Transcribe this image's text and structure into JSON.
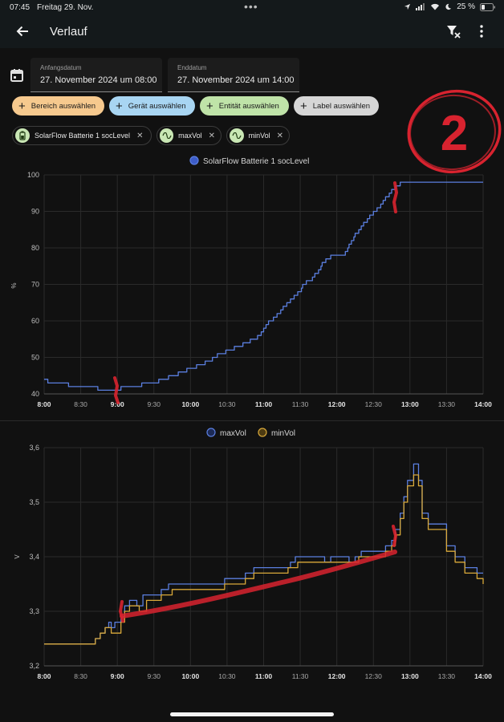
{
  "status": {
    "time": "07:45",
    "date": "Freitag 29. Nov.",
    "battery": "25 %"
  },
  "appbar": {
    "title": "Verlauf"
  },
  "dates": {
    "start_label": "Anfangsdatum",
    "start_value": "27. November 2024 um 08:00",
    "end_label": "Enddatum",
    "end_value": "27. November 2024 um 14:00"
  },
  "targets": [
    {
      "label": "Bereich auswählen",
      "color": "#f6c98e"
    },
    {
      "label": "Gerät auswählen",
      "color": "#a8d5f2"
    },
    {
      "label": "Entität auswählen",
      "color": "#bfe3a8"
    },
    {
      "label": "Label auswählen",
      "color": "#d6d6d6"
    }
  ],
  "entities": [
    {
      "label": "SolarFlow Batterie 1 socLevel",
      "icon": "battery-icon"
    },
    {
      "label": "maxVol",
      "icon": "sine-wave-icon"
    },
    {
      "label": "minVol",
      "icon": "sine-wave-icon"
    }
  ],
  "colors": {
    "blue": "#5b7fe0",
    "yellow": "#d9a93a",
    "grid": "#2a2a2a",
    "annotation": "#d8232f"
  },
  "annotation_text": "2",
  "chart_data": [
    {
      "type": "line",
      "title": "",
      "ylabel": "%",
      "xlabel": "",
      "xlim": [
        "8:00",
        "14:00"
      ],
      "ylim": [
        40,
        100
      ],
      "yticks": [
        40,
        50,
        60,
        70,
        80,
        90,
        100
      ],
      "xticks": [
        "8:00",
        "8:30",
        "9:00",
        "9:30",
        "10:00",
        "10:30",
        "11:00",
        "11:30",
        "12:00",
        "12:30",
        "13:00",
        "13:30",
        "14:00"
      ],
      "bold_xticks": [
        "8:00",
        "9:00",
        "10:00",
        "11:00",
        "12:00",
        "13:00",
        "14:00"
      ],
      "legend": [
        "SolarFlow Batterie 1 socLevel"
      ],
      "series": [
        {
          "name": "SolarFlow Batterie 1 socLevel",
          "color": "#5b7fe0",
          "step": true,
          "points": [
            [
              "8:00",
              44
            ],
            [
              "8:03",
              43
            ],
            [
              "8:20",
              42
            ],
            [
              "8:44",
              41
            ],
            [
              "9:03",
              42
            ],
            [
              "9:20",
              43
            ],
            [
              "9:34",
              44
            ],
            [
              "9:42",
              45
            ],
            [
              "9:50",
              46
            ],
            [
              "9:57",
              47
            ],
            [
              "10:05",
              48
            ],
            [
              "10:12",
              49
            ],
            [
              "10:18",
              50
            ],
            [
              "10:22",
              51
            ],
            [
              "10:29",
              52
            ],
            [
              "10:36",
              53
            ],
            [
              "10:43",
              54
            ],
            [
              "10:49",
              55
            ],
            [
              "10:55",
              56
            ],
            [
              "10:58",
              57
            ],
            [
              "11:00",
              58
            ],
            [
              "11:02",
              59
            ],
            [
              "11:04",
              60
            ],
            [
              "11:08",
              61
            ],
            [
              "11:11",
              62
            ],
            [
              "11:14",
              63
            ],
            [
              "11:16",
              64
            ],
            [
              "11:19",
              65
            ],
            [
              "11:22",
              66
            ],
            [
              "11:25",
              67
            ],
            [
              "11:28",
              68
            ],
            [
              "11:31",
              69
            ],
            [
              "11:32",
              70
            ],
            [
              "11:35",
              71
            ],
            [
              "11:40",
              72
            ],
            [
              "11:42",
              73
            ],
            [
              "11:45",
              74
            ],
            [
              "11:47",
              75
            ],
            [
              "11:48",
              76
            ],
            [
              "11:51",
              77
            ],
            [
              "11:55",
              78
            ],
            [
              "12:07",
              79
            ],
            [
              "12:09",
              80
            ],
            [
              "12:10",
              81
            ],
            [
              "12:12",
              82
            ],
            [
              "12:14",
              83
            ],
            [
              "12:15",
              84
            ],
            [
              "12:18",
              85
            ],
            [
              "12:20",
              86
            ],
            [
              "12:22",
              87
            ],
            [
              "12:25",
              88
            ],
            [
              "12:27",
              89
            ],
            [
              "12:30",
              90
            ],
            [
              "12:33",
              91
            ],
            [
              "12:36",
              92
            ],
            [
              "12:38",
              93
            ],
            [
              "12:40",
              94
            ],
            [
              "12:43",
              95
            ],
            [
              "12:45",
              96
            ],
            [
              "12:48",
              97
            ],
            [
              "12:52",
              98
            ],
            [
              "14:00",
              98
            ]
          ]
        }
      ]
    },
    {
      "type": "line",
      "title": "",
      "ylabel": "V",
      "xlabel": "",
      "xlim": [
        "8:00",
        "14:00"
      ],
      "ylim": [
        3.2,
        3.6
      ],
      "yticks": [
        "3,2",
        "3,3",
        "3,4",
        "3,5",
        "3,6"
      ],
      "xticks": [
        "8:00",
        "8:30",
        "9:00",
        "9:30",
        "10:00",
        "10:30",
        "11:00",
        "11:30",
        "12:00",
        "12:30",
        "13:00",
        "13:30",
        "14:00"
      ],
      "bold_xticks": [
        "8:00",
        "9:00",
        "10:00",
        "11:00",
        "12:00",
        "13:00",
        "14:00"
      ],
      "legend": [
        "maxVol",
        "minVol"
      ],
      "series": [
        {
          "name": "maxVol",
          "color": "#5b7fe0",
          "step": true,
          "points": [
            [
              "8:00",
              3.24
            ],
            [
              "8:42",
              3.25
            ],
            [
              "8:46",
              3.26
            ],
            [
              "8:50",
              3.27
            ],
            [
              "8:53",
              3.28
            ],
            [
              "8:55",
              3.27
            ],
            [
              "8:58",
              3.28
            ],
            [
              "9:03",
              3.29
            ],
            [
              "9:06",
              3.31
            ],
            [
              "9:10",
              3.32
            ],
            [
              "9:16",
              3.31
            ],
            [
              "9:21",
              3.33
            ],
            [
              "9:30",
              3.33
            ],
            [
              "9:36",
              3.34
            ],
            [
              "9:42",
              3.35
            ],
            [
              "9:53",
              3.35
            ],
            [
              "10:05",
              3.35
            ],
            [
              "10:15",
              3.35
            ],
            [
              "10:28",
              3.36
            ],
            [
              "10:45",
              3.37
            ],
            [
              "10:52",
              3.38
            ],
            [
              "11:02",
              3.38
            ],
            [
              "11:15",
              3.38
            ],
            [
              "11:22",
              3.39
            ],
            [
              "11:26",
              3.4
            ],
            [
              "11:40",
              3.4
            ],
            [
              "11:50",
              3.39
            ],
            [
              "11:55",
              3.4
            ],
            [
              "12:05",
              3.4
            ],
            [
              "12:10",
              3.39
            ],
            [
              "12:15",
              3.4
            ],
            [
              "12:20",
              3.41
            ],
            [
              "12:30",
              3.41
            ],
            [
              "12:40",
              3.42
            ],
            [
              "12:45",
              3.43
            ],
            [
              "12:48",
              3.45
            ],
            [
              "12:52",
              3.48
            ],
            [
              "12:55",
              3.51
            ],
            [
              "12:58",
              3.54
            ],
            [
              "13:03",
              3.57
            ],
            [
              "13:07",
              3.54
            ],
            [
              "13:10",
              3.48
            ],
            [
              "13:15",
              3.46
            ],
            [
              "13:25",
              3.46
            ],
            [
              "13:30",
              3.42
            ],
            [
              "13:37",
              3.4
            ],
            [
              "13:45",
              3.38
            ],
            [
              "13:55",
              3.37
            ],
            [
              "14:00",
              3.37
            ]
          ]
        },
        {
          "name": "minVol",
          "color": "#d9a93a",
          "step": true,
          "points": [
            [
              "8:00",
              3.24
            ],
            [
              "8:42",
              3.25
            ],
            [
              "8:46",
              3.26
            ],
            [
              "8:50",
              3.27
            ],
            [
              "8:55",
              3.26
            ],
            [
              "9:03",
              3.28
            ],
            [
              "9:06",
              3.3
            ],
            [
              "9:10",
              3.31
            ],
            [
              "9:18",
              3.3
            ],
            [
              "9:24",
              3.32
            ],
            [
              "9:30",
              3.32
            ],
            [
              "9:36",
              3.33
            ],
            [
              "9:45",
              3.34
            ],
            [
              "10:05",
              3.34
            ],
            [
              "10:15",
              3.34
            ],
            [
              "10:28",
              3.35
            ],
            [
              "10:45",
              3.36
            ],
            [
              "10:52",
              3.37
            ],
            [
              "11:02",
              3.37
            ],
            [
              "11:20",
              3.38
            ],
            [
              "11:28",
              3.39
            ],
            [
              "11:45",
              3.39
            ],
            [
              "11:55",
              3.39
            ],
            [
              "12:08",
              3.39
            ],
            [
              "12:18",
              3.4
            ],
            [
              "12:30",
              3.4
            ],
            [
              "12:40",
              3.41
            ],
            [
              "12:45",
              3.42
            ],
            [
              "12:48",
              3.44
            ],
            [
              "12:52",
              3.47
            ],
            [
              "12:55",
              3.5
            ],
            [
              "12:58",
              3.53
            ],
            [
              "13:03",
              3.55
            ],
            [
              "13:07",
              3.53
            ],
            [
              "13:10",
              3.47
            ],
            [
              "13:15",
              3.45
            ],
            [
              "13:25",
              3.45
            ],
            [
              "13:30",
              3.41
            ],
            [
              "13:37",
              3.39
            ],
            [
              "13:45",
              3.37
            ],
            [
              "13:55",
              3.36
            ],
            [
              "14:00",
              3.35
            ]
          ]
        }
      ]
    }
  ]
}
